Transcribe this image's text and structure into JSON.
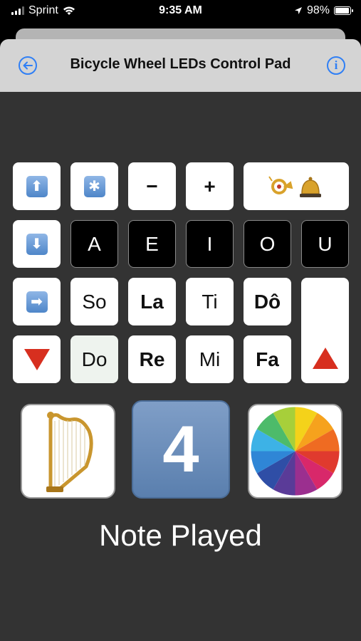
{
  "status": {
    "carrier": "Sprint",
    "time": "9:35 AM",
    "battery": "98%",
    "battery_level": 0.98
  },
  "nav": {
    "title": "Bicycle Wheel LEDs Control Pad",
    "back_icon": "back-arrow-icon",
    "info_icon": "info-icon",
    "info_glyph": "i"
  },
  "keys": {
    "up_arrow": "⬆",
    "asterisk": "✱",
    "minus": "−",
    "plus": "+",
    "horn_bell": "📯🛎",
    "down_arrow": "⬇",
    "vowels": [
      "A",
      "E",
      "I",
      "O",
      "U"
    ],
    "right_arrow": "➡",
    "notes_high": [
      "So",
      "La",
      "Ti",
      "Dô"
    ],
    "notes_low": [
      "Do",
      "Re",
      "Mi",
      "Fa"
    ]
  },
  "tiles": {
    "number": "4"
  },
  "note_played": "Note Played",
  "colors": {
    "accent": "#2f7ff5",
    "background": "#333333",
    "nav_bar": "#d4d4d4"
  }
}
